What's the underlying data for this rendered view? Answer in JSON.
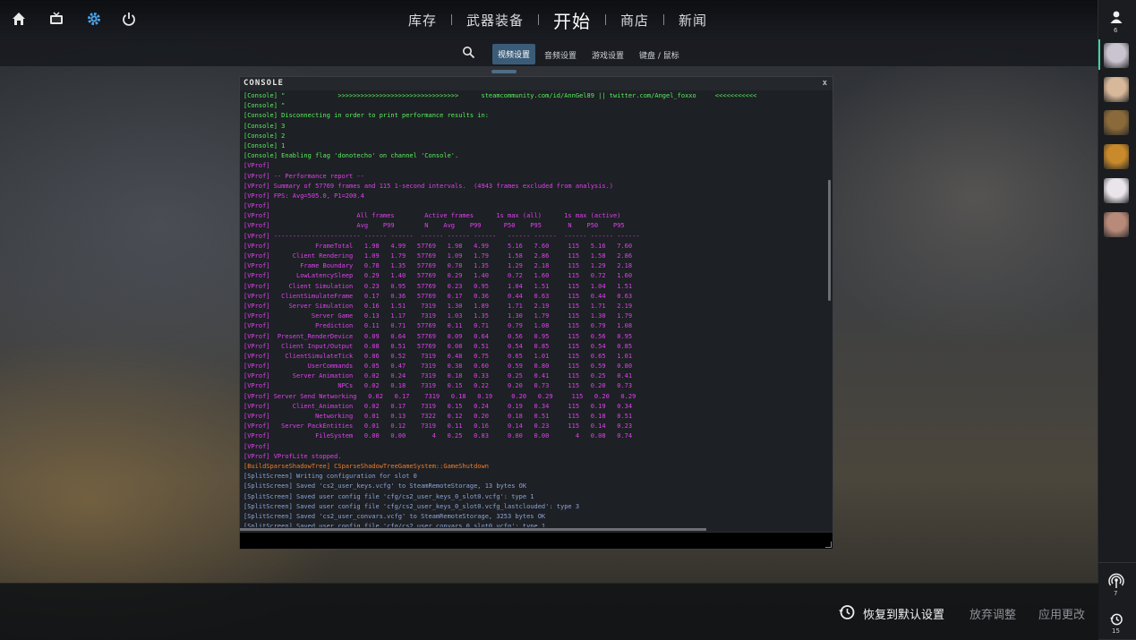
{
  "top_icons": [
    "home-icon",
    "tv-icon",
    "gear-icon",
    "power-icon"
  ],
  "nav": {
    "items": [
      {
        "label": "库存"
      },
      {
        "label": "武器装备"
      },
      {
        "label": "开始"
      },
      {
        "label": "商店"
      },
      {
        "label": "新闻"
      }
    ],
    "active": "开始"
  },
  "subnav": {
    "tabs": [
      {
        "label": "视频设置"
      },
      {
        "label": "音频设置"
      },
      {
        "label": "游戏设置"
      },
      {
        "label": "键盘 / 鼠标"
      }
    ],
    "active": "视频设置"
  },
  "console": {
    "title": "CONSOLE",
    "close_label": "x",
    "lines": [
      {
        "c": "green",
        "t": "[Console] \"              >>>>>>>>>>>>>>>>>>>>>>>>>>>>>>>>      steamcommunity.com/id/AnnGel89 || twitter.com/Angel_foxxo     <<<<<<<<<<<"
      },
      {
        "c": "green",
        "t": "[Console] \""
      },
      {
        "c": "green",
        "t": "[Console] Disconnecting in order to print performance results in:"
      },
      {
        "c": "green",
        "t": "[Console] 3"
      },
      {
        "c": "green",
        "t": "[Console] 2"
      },
      {
        "c": "green",
        "t": "[Console] 1"
      },
      {
        "c": "green",
        "t": "[Console] Enabling flag 'donotecho' on channel 'Console'."
      },
      {
        "c": "mag",
        "t": "[VProf]"
      },
      {
        "c": "mag",
        "t": "[VProf] -- Performance report --"
      },
      {
        "c": "mag",
        "t": "[VProf] Summary of 57769 frames and 115 1-second intervals.  (4943 frames excluded from analysis.)"
      },
      {
        "c": "mag",
        "t": "[VProf] FPS: Avg=505.0, P1=200.4"
      },
      {
        "c": "mag",
        "t": "[VProf]"
      },
      {
        "c": "mag",
        "t": "[VProf]                       All frames        Active frames      1s max (all)      1s max (active)"
      },
      {
        "c": "mag",
        "t": "[VProf]                       Avg    P99        N    Avg    P99      P50    P95       N    P50    P95"
      },
      {
        "c": "mag",
        "t": "[VProf] ----------------------- ------ ------  ------ ------ ------   ------ ------  ------ ------ ------"
      },
      {
        "c": "mag",
        "t": "[VProf]            FrameTotal   1.98   4.99   57769   1.98   4.99     5.16   7.60     115   5.16   7.60"
      },
      {
        "c": "mag",
        "t": "[VProf]      Client Rendering   1.09   1.79   57769   1.09   1.79     1.58   2.86     115   1.58   2.86"
      },
      {
        "c": "mag",
        "t": "[VProf]        Frame Boundary   0.78   1.35   57769   0.78   1.35     1.29   2.18     115   1.29   2.18"
      },
      {
        "c": "mag",
        "t": "[VProf]       LowLatencySleep   0.29   1.40   57769   0.29   1.40     0.72   1.60     115   0.72   1.60"
      },
      {
        "c": "mag",
        "t": "[VProf]     Client Simulation   0.23   0.95   57769   0.23   0.95     1.04   1.51     115   1.04   1.51"
      },
      {
        "c": "mag",
        "t": "[VProf]   ClientSimulateFrame   0.17   0.36   57769   0.17   0.36     0.44   0.63     115   0.44   0.63"
      },
      {
        "c": "mag",
        "t": "[VProf]     Server Simulation   0.16   1.51    7319   1.30   1.89     1.71   2.19     115   1.71   2.19"
      },
      {
        "c": "mag",
        "t": "[VProf]           Server Game   0.13   1.17    7319   1.03   1.35     1.30   1.79     115   1.30   1.79"
      },
      {
        "c": "mag",
        "t": "[VProf]            Prediction   0.11   0.71   57769   0.11   0.71     0.79   1.08     115   0.79   1.08"
      },
      {
        "c": "mag",
        "t": "[VProf]  Present_RenderDevice   0.09   0.64   57769   0.09   0.64     0.56   0.95     115   0.56   0.95"
      },
      {
        "c": "mag",
        "t": "[VProf]   Client Input/Output   0.08   0.51   57769   0.08   0.51     0.54   0.85     115   0.54   0.85"
      },
      {
        "c": "mag",
        "t": "[VProf]    ClientSimulateTick   0.06   0.52    7319   0.48   0.75     0.65   1.01     115   0.65   1.01"
      },
      {
        "c": "mag",
        "t": "[VProf]          UserCommands   0.05   0.47    7319   0.38   0.60     0.59   0.80     115   0.59   0.80"
      },
      {
        "c": "mag",
        "t": "[VProf]      Server Animation   0.02   0.24    7319   0.18   0.33     0.25   0.41     115   0.25   0.41"
      },
      {
        "c": "mag",
        "t": "[VProf]                  NPCs   0.02   0.18    7319   0.15   0.22     0.20   0.73     115   0.20   0.73"
      },
      {
        "c": "mag",
        "t": "[VProf] Server Send Networking   0.02   0.17    7319   0.18   0.19     0.20   0.29     115   0.20   0.29"
      },
      {
        "c": "mag",
        "t": "[VProf]      Client_Animation   0.02   0.17    7319   0.15   0.24     0.19   0.34     115   0.19   0.34"
      },
      {
        "c": "mag",
        "t": "[VProf]            Networking   0.01   0.13    7322   0.12   0.20     0.18   0.51     115   0.18   0.51"
      },
      {
        "c": "mag",
        "t": "[VProf]   Server PackEntities   0.01   0.12    7319   0.11   0.16     0.14   0.23     115   0.14   0.23"
      },
      {
        "c": "mag",
        "t": "[VProf]            FileSystem   0.00   0.00       4   0.25   0.83     0.00   0.00       4   0.08   0.74"
      },
      {
        "c": "mag",
        "t": "[VProf]"
      },
      {
        "c": "mag",
        "t": "[VProf] VProfLite stopped."
      },
      {
        "c": "orange",
        "t": "[BuildSparseShadowTree] CSparseShadowTreeGameSystem::GameShutdown"
      },
      {
        "c": "blue",
        "t": "[SplitScreen] Writing configuration for slot 0"
      },
      {
        "c": "blue",
        "t": "[SplitScreen] Saved 'cs2_user_keys.vcfg' to SteamRemoteStorage, 13 bytes OK"
      },
      {
        "c": "blue",
        "t": "[SplitScreen] Saved user config file 'cfg/cs2_user_keys_0_slot0.vcfg': type 1"
      },
      {
        "c": "blue",
        "t": "[SplitScreen] Saved user config file 'cfg/cs2_user_keys_0_slot0.vcfg_lastclouded': type 3"
      },
      {
        "c": "blue",
        "t": "[SplitScreen] Saved 'cs2_user_convars.vcfg' to SteamRemoteStorage, 3253 bytes OK"
      },
      {
        "c": "blue",
        "t": "[SplitScreen] Saved user config file 'cfg/cs2_user_convars_0_slot0.vcfg': type 1"
      }
    ]
  },
  "bottom": {
    "reset_label": "恢复到默认设置",
    "discard_label": "放弃调整",
    "apply_label": "应用更改"
  },
  "rail": {
    "friends_count": "6",
    "broadcast_count": "7",
    "history_count": "15",
    "avatar_colors": [
      "#c9c4cf",
      "#d8b89a",
      "#8a6a3a",
      "#c88a2a",
      "#e9e5ea",
      "#b88a7a"
    ]
  }
}
